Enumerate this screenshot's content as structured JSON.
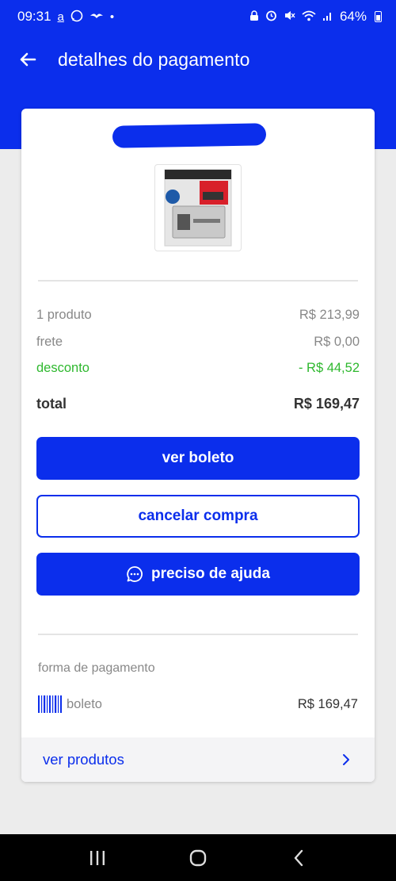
{
  "status_bar": {
    "time": "09:31",
    "battery_percent": "64%",
    "icons_left": [
      "a-icon",
      "whatsapp-icon",
      "bird-icon",
      "dot-icon"
    ],
    "icons_right": [
      "lock-icon",
      "alarm-icon",
      "mute-icon",
      "wifi-icon",
      "signal-icon",
      "battery-icon"
    ]
  },
  "header": {
    "title": "detalhes do pagamento"
  },
  "summary": {
    "products_label": "1 produto",
    "products_value": "R$ 213,99",
    "shipping_label": "frete",
    "shipping_value": "R$ 0,00",
    "discount_label": "desconto",
    "discount_value": "- R$ 44,52",
    "total_label": "total",
    "total_value": "R$ 169,47"
  },
  "actions": {
    "view_boleto": "ver boleto",
    "cancel_purchase": "cancelar compra",
    "need_help": "preciso de ajuda"
  },
  "payment": {
    "section_label": "forma de pagamento",
    "method": "boleto",
    "amount": "R$ 169,47"
  },
  "footer_link": {
    "label": "ver produtos"
  },
  "colors": {
    "brand_blue": "#0b2eec",
    "discount_green": "#2eb82e"
  }
}
